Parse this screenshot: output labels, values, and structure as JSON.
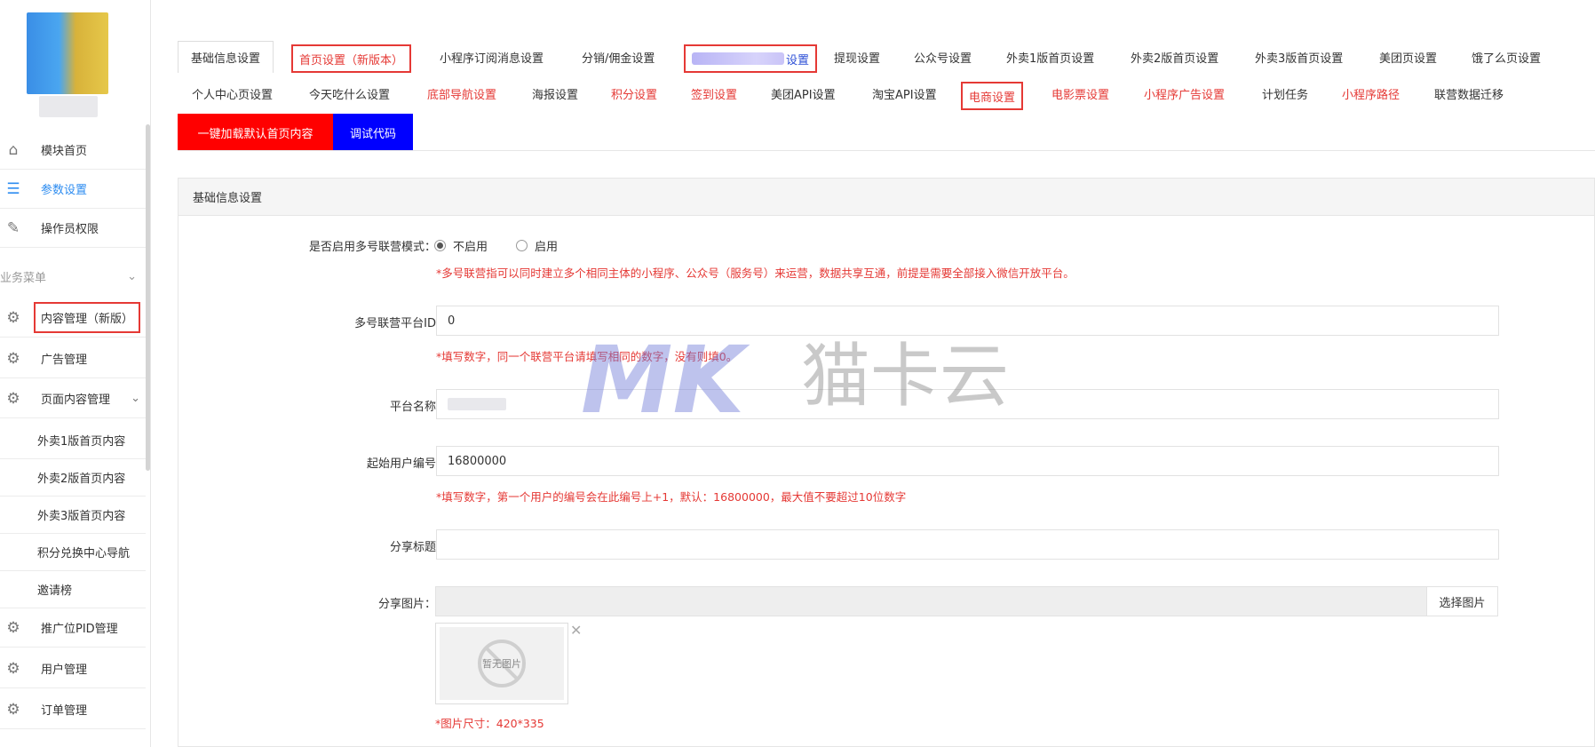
{
  "sidebar": {
    "nav_top": [
      {
        "label": "模块首页",
        "icon": "home-icon"
      },
      {
        "label": "参数设置",
        "icon": "settings-list-icon"
      },
      {
        "label": "操作员权限",
        "icon": "document-edit-icon"
      }
    ],
    "section_title": "业务菜单",
    "nav_main": [
      {
        "label": "内容管理（新版）",
        "icon": "gear-icon"
      },
      {
        "label": "广告管理",
        "icon": "gear-icon"
      },
      {
        "label": "页面内容管理",
        "icon": "gear-icon"
      }
    ],
    "sub_items": [
      "外卖1版首页内容",
      "外卖2版首页内容",
      "外卖3版首页内容",
      "积分兑换中心导航",
      "邀请榜"
    ],
    "nav_bottom": [
      {
        "label": "推广位PID管理",
        "icon": "gear-icon"
      },
      {
        "label": "用户管理",
        "icon": "gear-icon"
      },
      {
        "label": "订单管理",
        "icon": "gear-icon"
      }
    ]
  },
  "tabs_row1": [
    "基础信息设置",
    "首页设置（新版本）",
    "小程序订阅消息设置",
    "分销/佣金设置",
    "设置",
    "提现设置",
    "公众号设置",
    "外卖1版首页设置",
    "外卖2版首页设置",
    "外卖3版首页设置",
    "美团页设置",
    "饿了么页设置"
  ],
  "tabs_row2": [
    "个人中心页设置",
    "今天吃什么设置",
    "底部导航设置",
    "海报设置",
    "积分设置",
    "签到设置",
    "美团API设置",
    "淘宝API设置",
    "电商设置",
    "电影票设置",
    "小程序广告设置",
    "计划任务",
    "小程序路径",
    "联营数据迁移"
  ],
  "actions": {
    "load_default": "一键加载默认首页内容",
    "debug_code": "调试代码"
  },
  "panel": {
    "title": "基础信息设置",
    "multi_mode_label": "是否启用多号联营模式：",
    "radio_off": "不启用",
    "radio_on": "启用",
    "multi_mode_hint": "*多号联营指可以同时建立多个相同主体的小程序、公众号（服务号）来运营，数据共享互通，前提是需要全部接入微信开放平台。",
    "platform_id_label": "多号联营平台ID",
    "platform_id_value": "0",
    "platform_id_hint": "*填写数字，同一个联营平台请填写相同的数字，没有则填0。",
    "platform_name_label": "平台名称",
    "start_user_label": "起始用户编号",
    "start_user_value": "16800000",
    "start_user_hint": "*填写数字，第一个用户的编号会在此编号上+1，默认：16800000，最大值不要超过10位数字",
    "share_title_label": "分享标题",
    "share_image_label": "分享图片：",
    "choose_image": "选择图片",
    "no_image": "暂无图片",
    "image_size_hint": "*图片尺寸：420*335"
  },
  "watermark": {
    "text": "猫卡云",
    "logo": "MK"
  },
  "colors": {
    "accent": "#2d8cf0",
    "alert": "#e53935",
    "action_red": "#ff0000",
    "action_blue": "#0000ff"
  }
}
